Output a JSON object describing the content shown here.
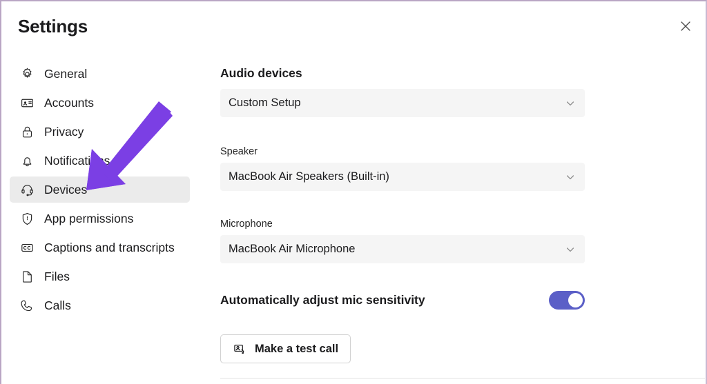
{
  "window": {
    "title": "Settings",
    "close_icon": "close-icon",
    "border_color": "#b9a6c4"
  },
  "sidebar": {
    "items": [
      {
        "label": "General",
        "icon": "gear-icon",
        "selected": false
      },
      {
        "label": "Accounts",
        "icon": "id-card-icon",
        "selected": false
      },
      {
        "label": "Privacy",
        "icon": "lock-icon",
        "selected": false
      },
      {
        "label": "Notifications",
        "icon": "bell-icon",
        "selected": false
      },
      {
        "label": "Devices",
        "icon": "headset-icon",
        "selected": true
      },
      {
        "label": "App permissions",
        "icon": "shield-icon",
        "selected": false
      },
      {
        "label": "Captions and transcripts",
        "icon": "cc-icon",
        "selected": false
      },
      {
        "label": "Files",
        "icon": "file-icon",
        "selected": false
      },
      {
        "label": "Calls",
        "icon": "phone-icon",
        "selected": false
      }
    ],
    "selected_background": "#ebebeb"
  },
  "main": {
    "section_title": "Audio devices",
    "audio_setup": {
      "value": "Custom Setup",
      "chevron_icon": "chevron-down-icon"
    },
    "speaker": {
      "label": "Speaker",
      "value": "MacBook Air Speakers (Built-in)",
      "chevron_icon": "chevron-down-icon"
    },
    "microphone": {
      "label": "Microphone",
      "value": "MacBook Air Microphone",
      "chevron_icon": "chevron-down-icon"
    },
    "mic_sensitivity": {
      "label": "Automatically adjust mic sensitivity",
      "state": "on",
      "accent_color": "#5b5fc7"
    },
    "test_call": {
      "label": "Make a test call",
      "icon": "test-call-icon"
    }
  },
  "annotation": {
    "arrow_color": "#7b3fe4",
    "points_to": "Devices"
  }
}
